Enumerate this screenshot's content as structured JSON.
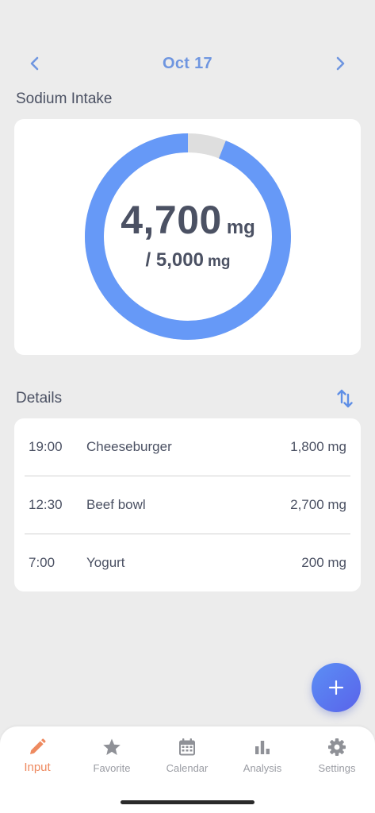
{
  "header": {
    "date": "Oct 17",
    "prev_icon": "chevron-left-icon",
    "next_icon": "chevron-right-icon"
  },
  "intake": {
    "title": "Sodium Intake",
    "value": "4,700",
    "unit": "mg",
    "limit": "/ 5,000",
    "limit_unit": "mg",
    "progress_fraction": 0.94
  },
  "details": {
    "title": "Details",
    "sort_icon": "sort-arrows-icon",
    "rows": [
      {
        "time": "19:00",
        "food": "Cheeseburger",
        "amount": "1,800 mg"
      },
      {
        "time": "12:30",
        "food": "Beef bowl",
        "amount": "2,700 mg"
      },
      {
        "time": "7:00",
        "food": "Yogurt",
        "amount": "200 mg"
      }
    ]
  },
  "fab": {
    "icon": "plus-icon"
  },
  "tabs": [
    {
      "label": "Input",
      "icon": "pencil-icon",
      "active": true
    },
    {
      "label": "Favorite",
      "icon": "star-icon",
      "active": false
    },
    {
      "label": "Calendar",
      "icon": "calendar-icon",
      "active": false
    },
    {
      "label": "Analysis",
      "icon": "bar-chart-icon",
      "active": false
    },
    {
      "label": "Settings",
      "icon": "gear-icon",
      "active": false
    }
  ],
  "colors": {
    "accent": "#6f96e0",
    "ring": "#6699f7",
    "ring_track": "#dedede",
    "active_tab": "#ee8a60",
    "inactive_tab": "#9a9ca3"
  }
}
